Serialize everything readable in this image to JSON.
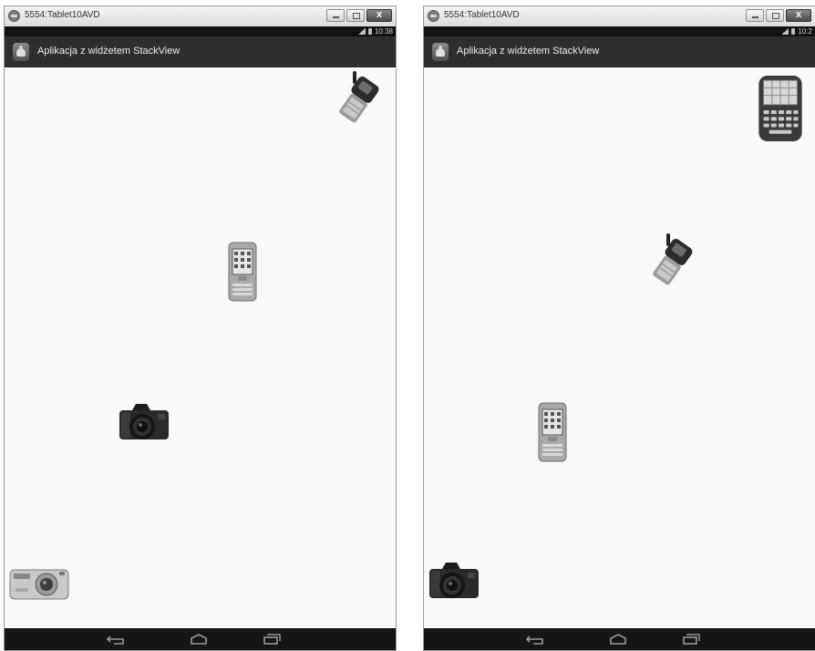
{
  "windows": [
    {
      "title": "5554:Tablet10AVD",
      "status_time": "10:38",
      "app_title": "Aplikacja z widżetem StackView"
    },
    {
      "title": "5554:Tablet10AVD",
      "status_time": "10:2",
      "app_title": "Aplikacja z widżetem StackView"
    }
  ],
  "colors": {
    "action_bar": "#2e2e2e",
    "status_bar": "#111111",
    "nav_bar": "#151515",
    "background": "#f9f9f9"
  },
  "stack_items": {
    "win1": [
      "flip-phone-image",
      "pda-phone-image",
      "dslr-camera-image",
      "compact-camera-image"
    ],
    "win2": [
      "keyboard-phone-image",
      "flip-phone-image",
      "pda-phone-image",
      "dslr-camera-image"
    ]
  }
}
